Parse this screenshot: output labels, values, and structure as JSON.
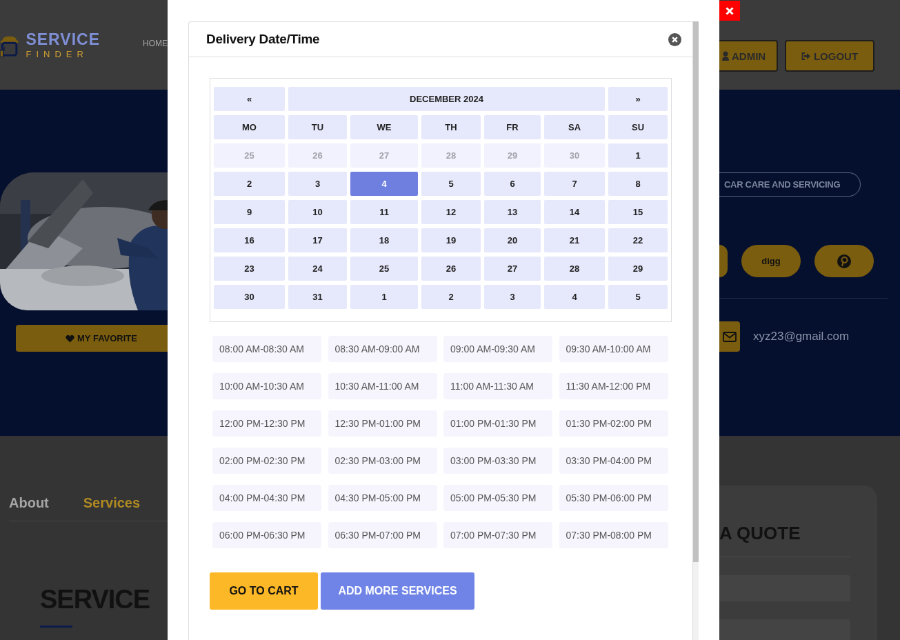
{
  "site_header": {
    "logo": {
      "title": "SERVICE",
      "subtitle": "FINDER"
    },
    "nav": [
      "HOME"
    ],
    "buttons": [
      {
        "label": "ADMIN",
        "kind": "admin"
      },
      {
        "label": "LOGOUT",
        "kind": "logout"
      }
    ]
  },
  "hero": {
    "favorite_button": "MY FAVORITE",
    "category_tag": "CAR CARE AND SERVICING",
    "social_buttons": [
      {
        "kind": "cut"
      },
      {
        "kind": "text",
        "label": "digg"
      },
      {
        "kind": "pinterest"
      }
    ],
    "email": "xyz23@gmail.com"
  },
  "tabs": [
    {
      "label": "About",
      "selected": false
    },
    {
      "label": "Services",
      "selected": true
    }
  ],
  "section_heading": "SERVICE",
  "quote_card": {
    "title": "A QUOTE"
  },
  "modal": {
    "title": "Delivery Date/Time",
    "calendar": {
      "prev": "«",
      "month": "DECEMBER 2024",
      "next": "»",
      "weekdays": [
        "MO",
        "TU",
        "WE",
        "TH",
        "FR",
        "SA",
        "SU"
      ],
      "days": [
        {
          "label": "25",
          "outside": true,
          "selected": false
        },
        {
          "label": "26",
          "outside": true,
          "selected": false
        },
        {
          "label": "27",
          "outside": true,
          "selected": false
        },
        {
          "label": "28",
          "outside": true,
          "selected": false
        },
        {
          "label": "29",
          "outside": true,
          "selected": false
        },
        {
          "label": "30",
          "outside": true,
          "selected": false
        },
        {
          "label": "1",
          "outside": false,
          "selected": false
        },
        {
          "label": "2",
          "outside": false,
          "selected": false
        },
        {
          "label": "3",
          "outside": false,
          "selected": false
        },
        {
          "label": "4",
          "outside": false,
          "selected": true
        },
        {
          "label": "5",
          "outside": false,
          "selected": false
        },
        {
          "label": "6",
          "outside": false,
          "selected": false
        },
        {
          "label": "7",
          "outside": false,
          "selected": false
        },
        {
          "label": "8",
          "outside": false,
          "selected": false
        },
        {
          "label": "9",
          "outside": false,
          "selected": false
        },
        {
          "label": "10",
          "outside": false,
          "selected": false
        },
        {
          "label": "11",
          "outside": false,
          "selected": false
        },
        {
          "label": "12",
          "outside": false,
          "selected": false
        },
        {
          "label": "13",
          "outside": false,
          "selected": false
        },
        {
          "label": "14",
          "outside": false,
          "selected": false
        },
        {
          "label": "15",
          "outside": false,
          "selected": false
        },
        {
          "label": "16",
          "outside": false,
          "selected": false
        },
        {
          "label": "17",
          "outside": false,
          "selected": false
        },
        {
          "label": "18",
          "outside": false,
          "selected": false
        },
        {
          "label": "19",
          "outside": false,
          "selected": false
        },
        {
          "label": "20",
          "outside": false,
          "selected": false
        },
        {
          "label": "21",
          "outside": false,
          "selected": false
        },
        {
          "label": "22",
          "outside": false,
          "selected": false
        },
        {
          "label": "23",
          "outside": false,
          "selected": false
        },
        {
          "label": "24",
          "outside": false,
          "selected": false
        },
        {
          "label": "25",
          "outside": false,
          "selected": false
        },
        {
          "label": "26",
          "outside": false,
          "selected": false
        },
        {
          "label": "27",
          "outside": false,
          "selected": false
        },
        {
          "label": "28",
          "outside": false,
          "selected": false
        },
        {
          "label": "29",
          "outside": false,
          "selected": false
        },
        {
          "label": "30",
          "outside": false,
          "selected": false
        },
        {
          "label": "31",
          "outside": false,
          "selected": false
        },
        {
          "label": "1",
          "outside": false,
          "selected": false
        },
        {
          "label": "2",
          "outside": false,
          "selected": false
        },
        {
          "label": "3",
          "outside": false,
          "selected": false
        },
        {
          "label": "4",
          "outside": false,
          "selected": false
        },
        {
          "label": "5",
          "outside": false,
          "selected": false
        }
      ]
    },
    "time_slots": [
      {
        "label": "08:00 AM-08:30 AM",
        "selected": false
      },
      {
        "label": "08:30 AM-09:00 AM",
        "selected": false
      },
      {
        "label": "09:00 AM-09:30 AM",
        "selected": false
      },
      {
        "label": "09:30 AM-10:00 AM",
        "selected": false
      },
      {
        "label": "10:00 AM-10:30 AM",
        "selected": false
      },
      {
        "label": "10:30 AM-11:00 AM",
        "selected": false
      },
      {
        "label": "11:00 AM-11:30 AM",
        "selected": false
      },
      {
        "label": "11:30 AM-12:00 PM",
        "selected": false
      },
      {
        "label": "12:00 PM-12:30 PM",
        "selected": false
      },
      {
        "label": "12:30 PM-01:00 PM",
        "selected": false
      },
      {
        "label": "01:00 PM-01:30 PM",
        "selected": false
      },
      {
        "label": "01:30 PM-02:00 PM",
        "selected": false
      },
      {
        "label": "02:00 PM-02:30 PM",
        "selected": false
      },
      {
        "label": "02:30 PM-03:00 PM",
        "selected": false
      },
      {
        "label": "03:00 PM-03:30 PM",
        "selected": false
      },
      {
        "label": "03:30 PM-04:00 PM",
        "selected": false
      },
      {
        "label": "04:00 PM-04:30 PM",
        "selected": false
      },
      {
        "label": "04:30 PM-05:00 PM",
        "selected": false
      },
      {
        "label": "05:00 PM-05:30 PM",
        "selected": false
      },
      {
        "label": "05:30 PM-06:00 PM",
        "selected": false
      },
      {
        "label": "06:00 PM-06:30 PM",
        "selected": false
      },
      {
        "label": "06:30 PM-07:00 PM",
        "selected": false
      },
      {
        "label": "07:00 PM-07:30 PM",
        "selected": false
      },
      {
        "label": "07:30 PM-08:00 PM",
        "selected": false
      }
    ],
    "buttons": [
      {
        "label": "GO TO CART",
        "kind": "primary"
      },
      {
        "label": "ADD MORE SERVICES",
        "kind": "secondary"
      }
    ]
  }
}
